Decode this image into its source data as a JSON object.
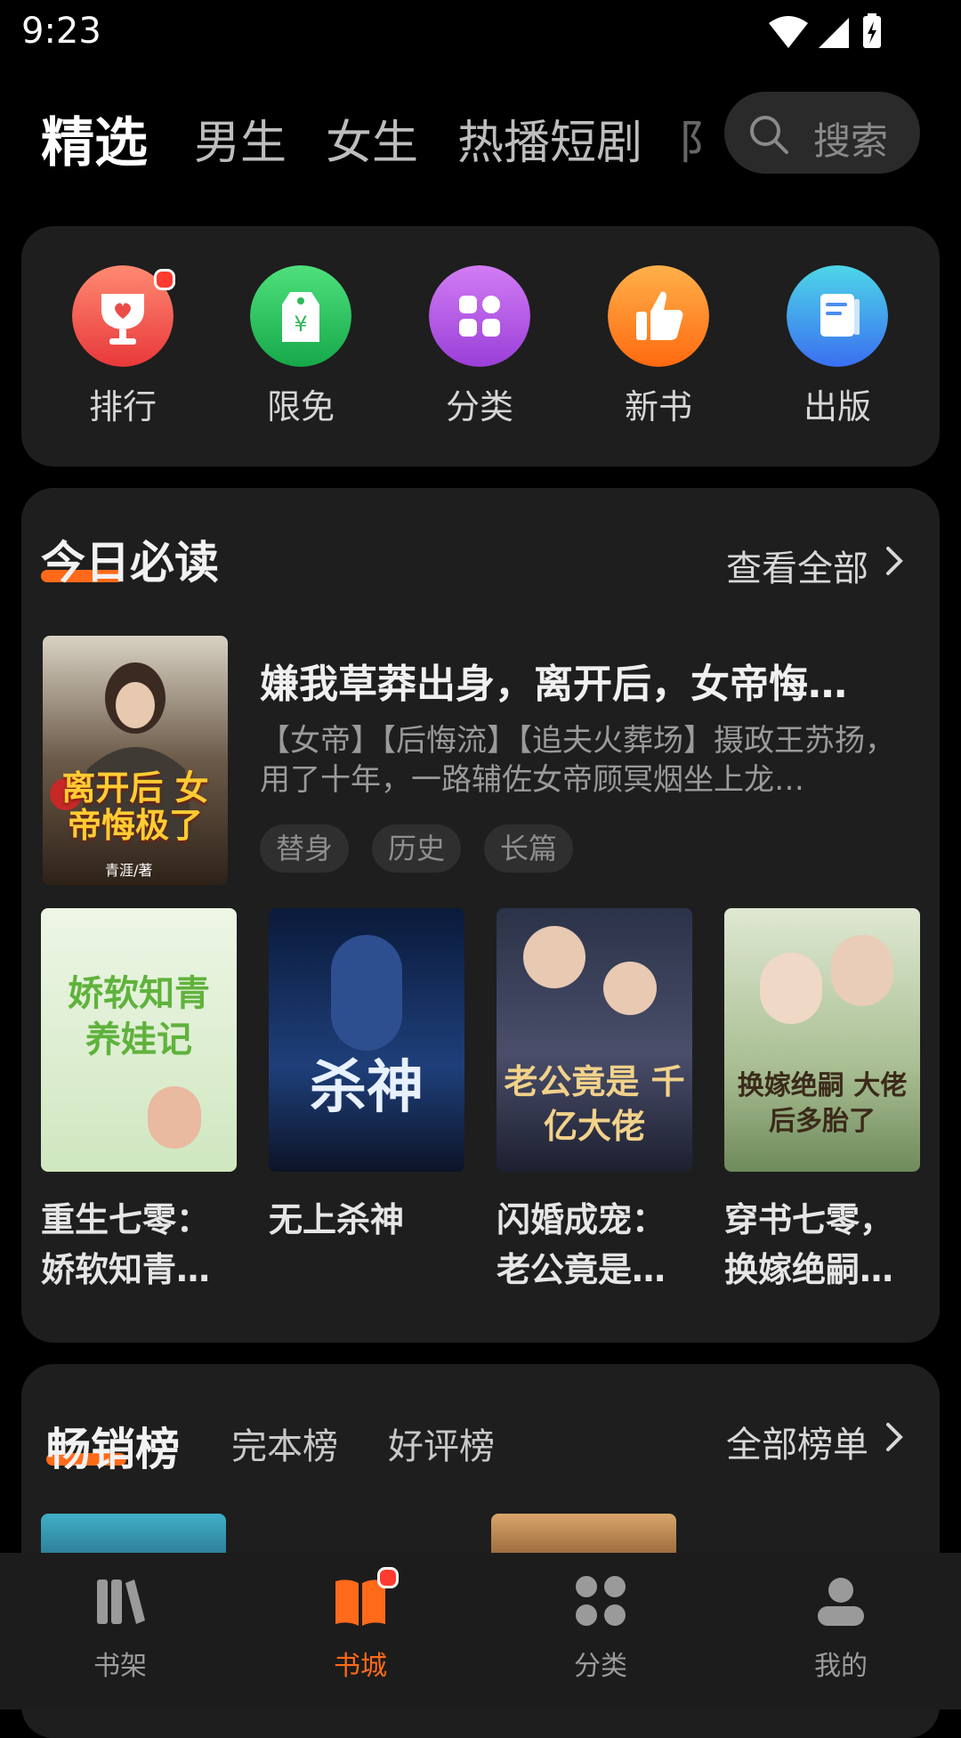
{
  "status": {
    "time": "9:23"
  },
  "tabs": [
    {
      "label": "精选",
      "active": true
    },
    {
      "label": "男生"
    },
    {
      "label": "女生"
    },
    {
      "label": "热播短剧"
    },
    {
      "label": "阝"
    }
  ],
  "search": {
    "placeholder": "搜索"
  },
  "quick": [
    {
      "label": "排行",
      "icon": "trophy-icon",
      "color": "#f0534a"
    },
    {
      "label": "限免",
      "icon": "price-tag-icon",
      "color": "#2fc463"
    },
    {
      "label": "分类",
      "icon": "grid-icon",
      "color": "#b356e6"
    },
    {
      "label": "新书",
      "icon": "thumbs-up-icon",
      "color": "#ff8a1c"
    },
    {
      "label": "出版",
      "icon": "book-icon",
      "color": "#3f8ff2"
    }
  ],
  "daily": {
    "title": "今日必读",
    "more": "查看全部",
    "featured": {
      "title": "嫌我草莽出身，离开后，女帝悔…",
      "desc": "【女帝】【后悔流】【追夫火葬场】摄政王苏扬，用了十年，一路辅佐女帝顾冥烟坐上龙…",
      "tags": [
        "替身",
        "历史",
        "长篇"
      ],
      "cover_text": "离开后 女帝悔极了",
      "cover_author": "青涯/著"
    },
    "books": [
      {
        "title_line1": "重生七零：",
        "title_line2": "娇软知青…",
        "cover_text": "娇软知青 养娃记"
      },
      {
        "title_line1": "无上杀神",
        "title_line2": "",
        "cover_text": "杀神"
      },
      {
        "title_line1": "闪婚成宠：",
        "title_line2": "老公竟是…",
        "cover_text": "老公竟是 千亿大佬"
      },
      {
        "title_line1": "穿书七零，",
        "title_line2": "换嫁绝嗣…",
        "cover_text": "换嫁绝嗣 大佬后多胎了"
      }
    ]
  },
  "bestseller": {
    "title": "畅销榜",
    "subtabs": [
      "完本榜",
      "好评榜"
    ],
    "more": "全部榜单"
  },
  "nav": [
    {
      "label": "书架",
      "icon": "bookshelf-icon"
    },
    {
      "label": "书城",
      "icon": "bookstore-icon",
      "active": true
    },
    {
      "label": "分类",
      "icon": "category-icon"
    },
    {
      "label": "我的",
      "icon": "profile-icon"
    }
  ],
  "colors": {
    "accent": "#ff6a1a",
    "card": "#1e1e1e",
    "background": "#000000"
  }
}
